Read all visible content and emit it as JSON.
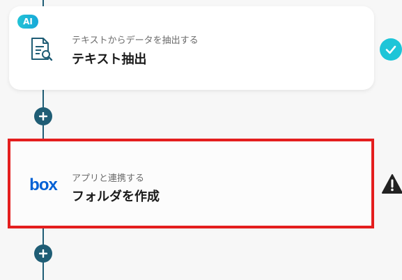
{
  "flow": {
    "steps": [
      {
        "badge": "AI",
        "subtitle": "テキストからデータを抽出する",
        "title": "テキスト抽出",
        "icon": "document-search-icon",
        "status": "complete"
      },
      {
        "logo_text": "box",
        "subtitle": "アプリと連携する",
        "title": "フォルダを作成",
        "icon": "box-logo-icon",
        "status": "warning",
        "selected": true
      }
    ]
  },
  "colors": {
    "background": "#f7f7f7",
    "connector": "#1f5d75",
    "selected_border": "#e41e1e",
    "ai_badge": "#1ec5d8",
    "check": "#1ec5d8",
    "box_brand": "#0061d5",
    "warning": "#222222"
  }
}
